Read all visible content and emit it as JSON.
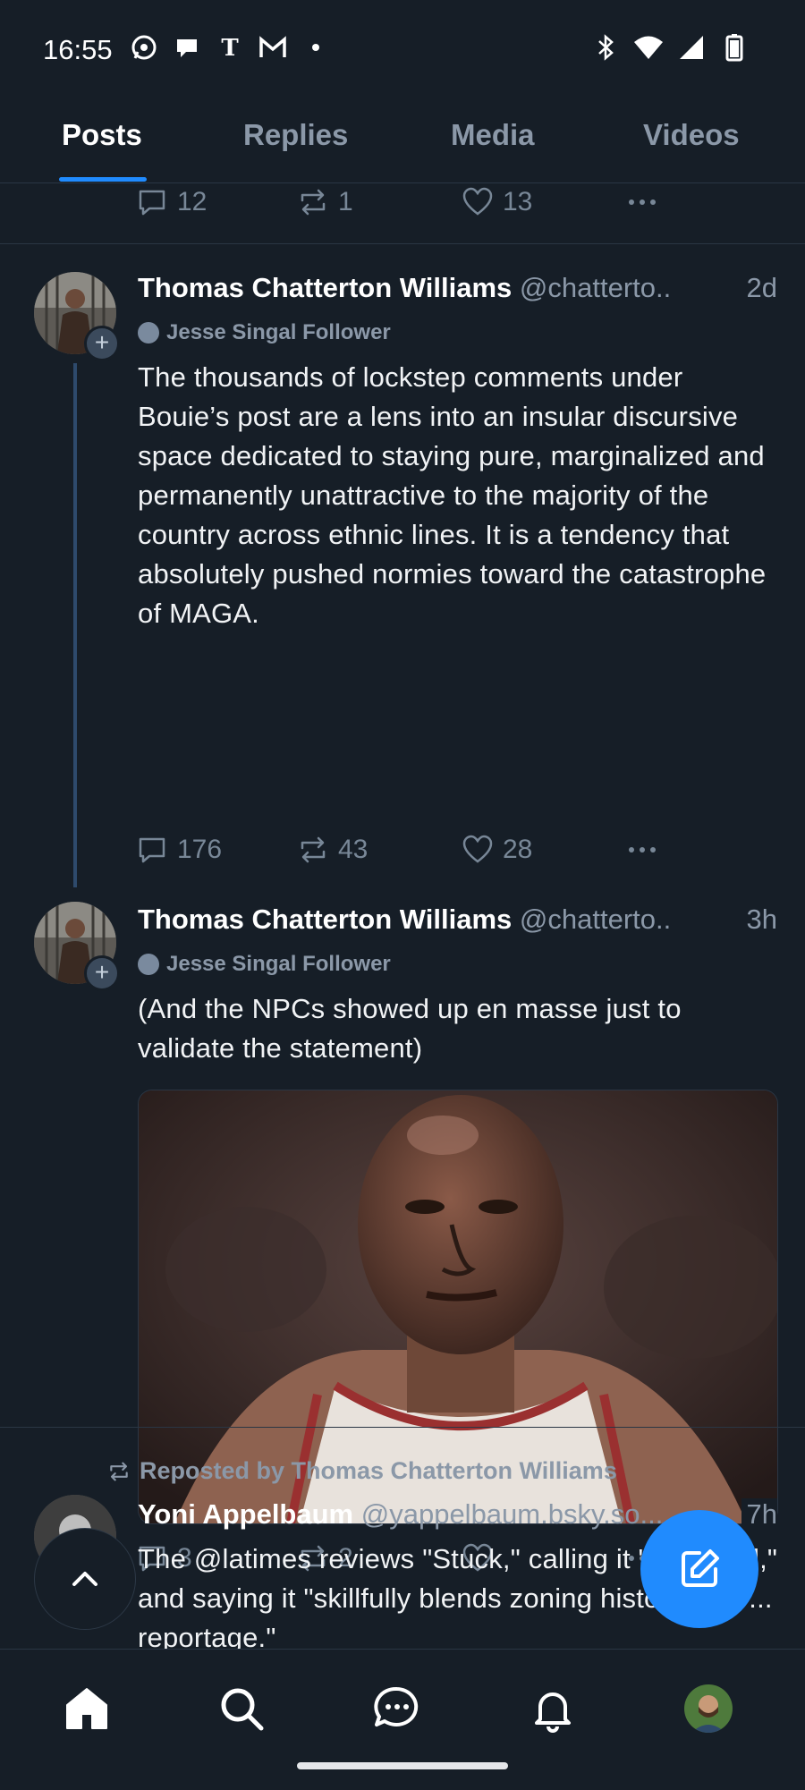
{
  "status_bar": {
    "time": "16:55",
    "left_icons": [
      "whatsapp-icon",
      "chat-bubble-icon",
      "nyt-icon",
      "gmail-icon",
      "dot-icon"
    ],
    "right_icons": [
      "bluetooth-icon",
      "wifi-icon",
      "signal-icon",
      "battery-icon"
    ]
  },
  "tabs": [
    {
      "label": "Posts",
      "active": true
    },
    {
      "label": "Replies",
      "active": false
    },
    {
      "label": "Media",
      "active": false
    },
    {
      "label": "Videos",
      "active": false
    }
  ],
  "top_partial_post": {
    "replies": "12",
    "reposts": "1",
    "likes": "13"
  },
  "posts": [
    {
      "author": "Thomas Chatterton Williams",
      "handle": "@chatterto..",
      "time": "2d",
      "follower_note": "Jesse Singal Follower",
      "text": "The thousands of lockstep comments under Bouie’s post are a lens into an insular discursive space dedicated to staying pure, marginalized and permanently unattractive to the majority of the country across ethnic lines. It is a tendency that absolutely pushed normies toward the catastrophe of MAGA.",
      "replies": "176",
      "reposts": "43",
      "likes": "28"
    },
    {
      "author": "Thomas Chatterton Williams",
      "handle": "@chatterto..",
      "time": "3h",
      "follower_note": "Jesse Singal Follower",
      "text": "(And the NPCs showed up en masse just to validate the statement)",
      "replies": "3",
      "reposts": "2",
      "likes": ""
    }
  ],
  "repost": {
    "label": "Reposted by Thomas Chatterton Williams",
    "author": "Yoni Appelbaum",
    "handle": "@yappelbaum.bsky.so...",
    "time": "7h",
    "text": "The @latimes reviews \"Stuck,\" calling it \"insightful,\" and saying it \"skillfully blends zoning history with ... reportage.\""
  },
  "bottom_nav": [
    "home-icon",
    "search-icon",
    "messages-icon",
    "notifications-icon",
    "profile-avatar"
  ],
  "colors": {
    "background": "#161e27",
    "accent": "#208bfe",
    "muted": "#8b98a8"
  }
}
